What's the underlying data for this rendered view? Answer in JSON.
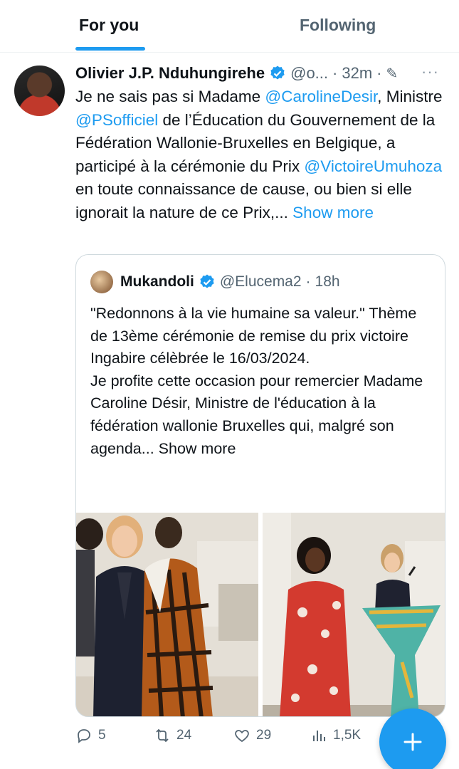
{
  "tabs": {
    "for_you": "For you",
    "following": "Following"
  },
  "tweet": {
    "author": "Olivier J.P. Nduhungirehe",
    "handle": "@o...",
    "dot": "·",
    "time": "32m",
    "dot2": "·",
    "more_dots": "···",
    "text": {
      "p1": "Je ne sais pas si Madame ",
      "m1": "@CarolineDesir",
      "p2": ", Ministre ",
      "m2": "@PSofficiel",
      "p3": " de l’Éducation du Gouvernement de la Fédération Wallonie-Bruxelles en Belgique, a participé à la cérémonie du Prix ",
      "m3": "@VictoireUmuhoza",
      "p4": " en toute connaissance de cause, ou bien si elle ignorait la nature de ce Prix,...",
      "show_more": "Show more"
    },
    "quote": {
      "author": "Mukandoli",
      "handle": "@Elucema2",
      "dot": "·",
      "time": "18h",
      "text": "\"Redonnons à la vie humaine sa valeur.\" Thème de 13ème cérémonie de remise du prix victoire Ingabire célèbrée le 16/03/2024.\nJe profite cette occasion pour remercier Madame Caroline Désir, Ministre de l'éducation à la fédération wallonie Bruxelles qui, malgré son agenda...",
      "show_more": "Show more"
    },
    "actions": {
      "replies": "5",
      "reposts": "24",
      "likes": "29",
      "views": "1,5K"
    }
  },
  "colors": {
    "accent": "#1d9bf0",
    "text": "#0f1419",
    "secondary": "#536471"
  },
  "icons": [
    "verified-badge-icon",
    "pen-icon",
    "more-icon",
    "reply-icon",
    "repost-icon",
    "like-icon",
    "views-icon",
    "plus-icon"
  ]
}
